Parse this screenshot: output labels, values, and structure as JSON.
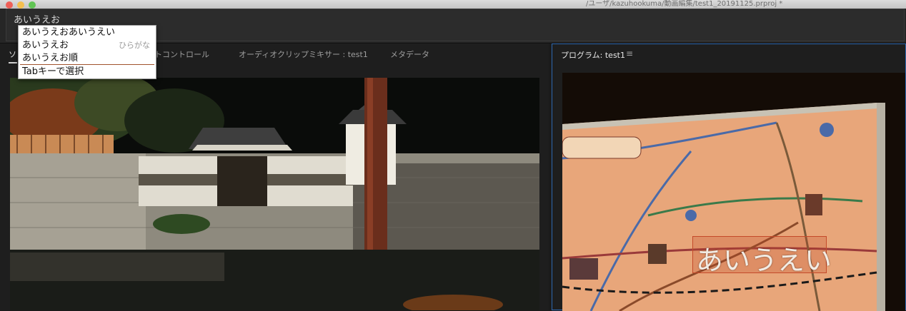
{
  "window": {
    "title": "/ユーザ/kazuhookuma/動画編集/test1_20191125.prproj *"
  },
  "title_input": {
    "value": "あいうえお"
  },
  "ime": {
    "candidates": [
      "あいうえおあいうえい",
      "あいうえお",
      "あいうえお順"
    ],
    "hint": "ひらがな",
    "footer": "Tabキーで選択"
  },
  "source_panel": {
    "tabs": [
      {
        "label": "ソ"
      },
      {
        "label": "トコントロール"
      },
      {
        "label": "オーディオクリップミキサー : test1"
      },
      {
        "label": "メタデータ"
      }
    ]
  },
  "program_panel": {
    "title": "プログラム: test1",
    "menu_icon": "hamburger-icon",
    "caption": "あいうえい",
    "accent_color": "#2e68b0"
  }
}
